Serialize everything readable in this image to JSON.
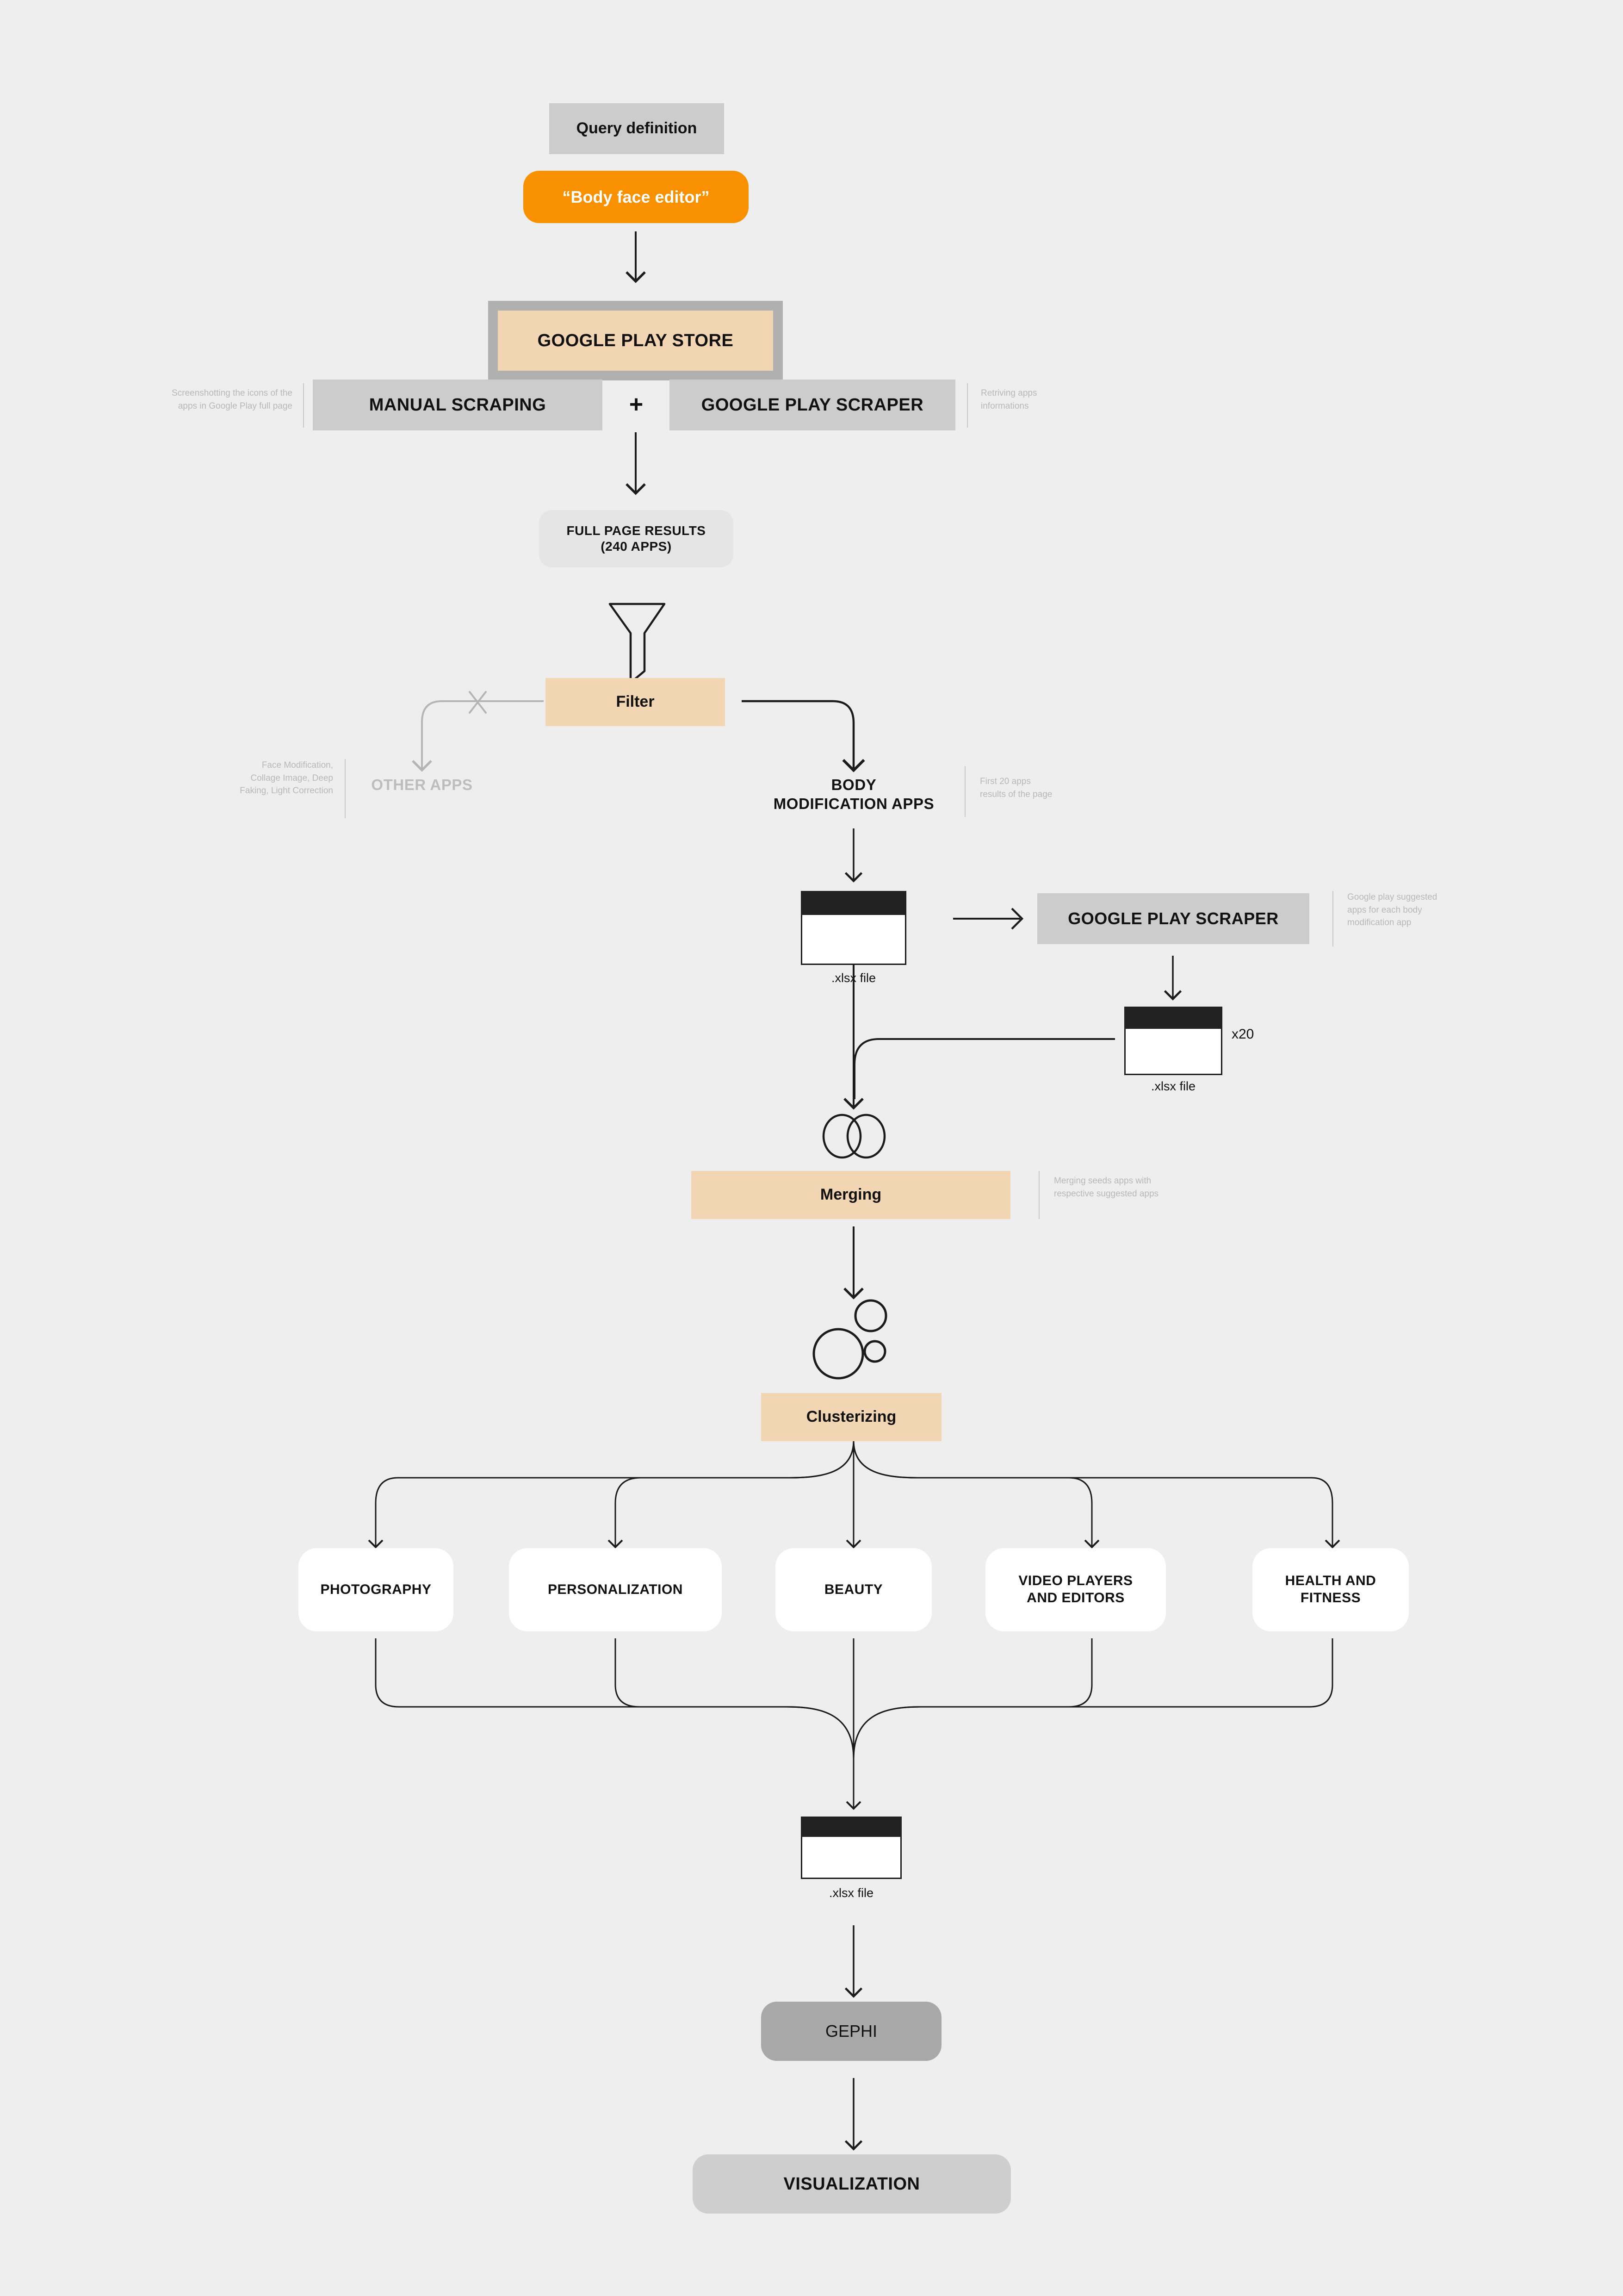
{
  "diagram": {
    "title": "Google Play app scraping and clustering methodology flowchart",
    "background_color": "#eeeeee",
    "accent_orange": "#f99000",
    "accent_peach": "#f2d5b3",
    "gray_box": "#cccccc",
    "gray_dark": "#a8a8a8",
    "gray_soft": "#cecece",
    "muted_text": "#b8b8b8"
  },
  "step_query_definition": {
    "label": "Query definition"
  },
  "step_query_value": {
    "label": "“Body face editor”"
  },
  "step_store": {
    "label": "GOOGLE PLAY STORE"
  },
  "step_manual_scraping": {
    "label": "MANUAL SCRAPING",
    "note": "Screenshotting the icons of the\napps in Google Play full page"
  },
  "step_plus": {
    "label": "+"
  },
  "step_scraper_1": {
    "label": "GOOGLE PLAY SCRAPER",
    "note": "Retriving apps\ninformations"
  },
  "step_full_page_results": {
    "label": "FULL PAGE RESULTS\n(240 APPS)"
  },
  "step_filter": {
    "label": "Filter"
  },
  "step_other_apps": {
    "label": "OTHER APPS",
    "note": "Face Modification,\nCollage Image, Deep\nFaking, Light Correction"
  },
  "step_body_modification_apps": {
    "label": "BODY\nMODIFICATION APPS",
    "note": "First 20 apps\nresults of the page"
  },
  "file_seed": {
    "caption": ".xlsx file"
  },
  "step_scraper_2": {
    "label": "GOOGLE PLAY SCRAPER",
    "note": "Google play suggested\napps for each body\nmodification app"
  },
  "file_suggested": {
    "caption": ".xlsx file",
    "multiplier": "x20"
  },
  "step_merging": {
    "label": "Merging",
    "note": "Merging seeds apps with\nrespective suggested apps"
  },
  "step_clusterizing": {
    "label": "Clusterizing"
  },
  "clusters": [
    {
      "label": "PHOTOGRAPHY"
    },
    {
      "label": "PERSONALIZATION"
    },
    {
      "label": "BEAUTY"
    },
    {
      "label": "VIDEO PLAYERS\nAND EDITORS"
    },
    {
      "label": "HEALTH AND\nFITNESS"
    }
  ],
  "file_final": {
    "caption": ".xlsx file"
  },
  "step_gephi": {
    "label": "GEPHI"
  },
  "step_visualization": {
    "label": "VISUALIZATION"
  },
  "icons": {
    "funnel": "funnel-icon",
    "venn": "venn-icon",
    "bubbles": "bubbles-icon",
    "cross": "cross-icon",
    "spreadsheet": "spreadsheet-icon"
  }
}
